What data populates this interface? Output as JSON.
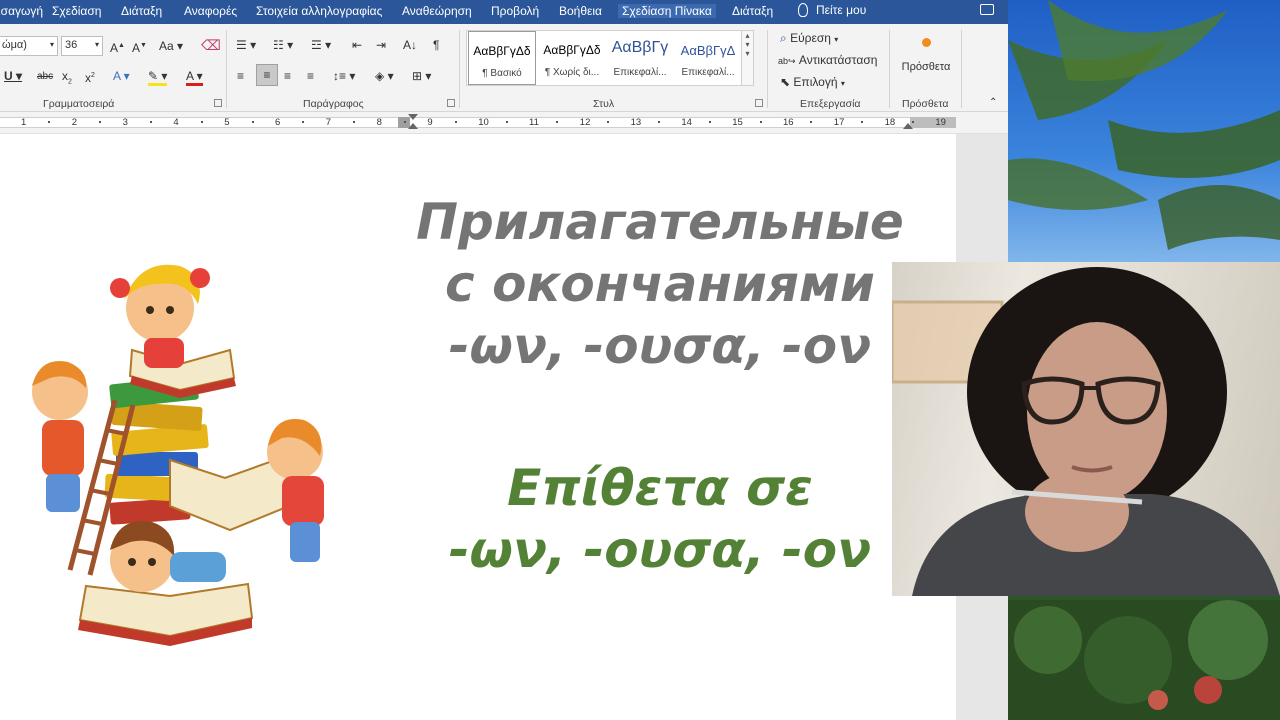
{
  "menubar": {
    "tabs": [
      "ισαγωγή",
      "Σχεδίαση",
      "Διάταξη",
      "Αναφορές",
      "Στοιχεία αλληλογραφίας",
      "Αναθεώρηση",
      "Προβολή",
      "Βοήθεια",
      "Σχεδίαση Πίνακα",
      "Διάταξη"
    ],
    "active_tab": "Σχεδίαση Πίνακα",
    "tell_me": "Πείτε μου"
  },
  "ribbon": {
    "font_name": "ώμα)",
    "font_size": "36",
    "groups": {
      "font": "Γραμματοσειρά",
      "paragraph": "Παράγραφος",
      "styles": "Στυλ",
      "editing": "Επεξεργασία",
      "addins": "Πρόσθετα"
    },
    "styles": [
      {
        "preview": "ΑαΒβΓγΔδ",
        "name": "¶ Βασικό"
      },
      {
        "preview": "ΑαΒβΓγΔδ",
        "name": "¶ Χωρίς δι..."
      },
      {
        "preview": "ΑαΒβΓγ",
        "name": "Επικεφαλί..."
      },
      {
        "preview": "ΑαΒβΓγΔ",
        "name": "Επικεφαλί..."
      }
    ],
    "editing": {
      "find": "Εύρεση",
      "replace": "Αντικατάσταση",
      "select": "Επιλογή"
    },
    "addins_button": "Πρόσθετα"
  },
  "ruler": {
    "numbers": [
      "1",
      "2",
      "3",
      "4",
      "5",
      "6",
      "7",
      "8",
      "9",
      "10",
      "11",
      "12",
      "13",
      "14",
      "15",
      "16",
      "17",
      "18",
      "19"
    ]
  },
  "document": {
    "russian_lines": [
      "Прилагательные",
      "с окончаниями",
      "-ων, -ουσα, -ον"
    ],
    "greek_lines": [
      "Επίθετα σε",
      "-ων, -ουσα, -ον"
    ]
  },
  "colors": {
    "ribbon_blue": "#2b579a",
    "russian_text": "#757575",
    "greek_text": "#538135"
  }
}
